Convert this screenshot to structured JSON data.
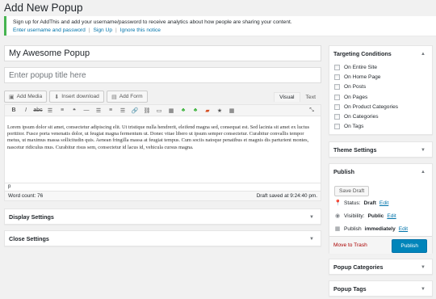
{
  "page": {
    "title": "Add New Popup"
  },
  "notice": {
    "message": "Sign up for AddThis and add your username/password to receive analytics about how people are sharing your content.",
    "links": [
      "Enter username and password",
      "Sign Up",
      "Ignore this notice"
    ],
    "accent_color": "#46b450"
  },
  "editor": {
    "title_value": "My Awesome Popup",
    "subtitle_placeholder": "Enter popup title here",
    "media_buttons": [
      {
        "label": "Add Media",
        "icon": "media-icon"
      },
      {
        "label": "Insert download",
        "icon": "download-icon"
      },
      {
        "label": "Add Form",
        "icon": "form-icon"
      }
    ],
    "tabs": [
      "Visual",
      "Text"
    ],
    "toolbar_icons": [
      "bold-icon",
      "italic-icon",
      "strikethrough-icon",
      "bullet-list-icon",
      "numbered-list-icon",
      "blockquote-icon",
      "horizontal-line-icon",
      "align-left-icon",
      "align-center-icon",
      "align-right-icon",
      "link-icon",
      "unlink-icon",
      "insert-more-icon",
      "toolbar-toggle-icon",
      "shortcode-green-icon",
      "shortcode-green-2-icon",
      "shortcode-red-icon",
      "star-icon",
      "table-icon",
      "fullscreen-icon"
    ],
    "content": "Lorem ipsum dolor sit amet, consectetur adipiscing elit. Ut tristique nulla hendrerit, eleifend magna sed, consequat est. Sed lacinia sit amet ex luctus porttitor. Fusce porta venenatis dolor, ut feugiat magna fermentum ut. Donec vitae libero ut ipsum semper consectetur. Curabitur convallis tempor metus, ut maximus massa sollicitudin quis. Aenean fringilla massa at feugiat tempus. Cum sociis natoque penatibus et magnis dis parturient montes, nascetur ridiculus mus. Curabitur risus sem, consectetur id lacus id, vehicula cursus magna.",
    "path": "p",
    "word_count": "Word count: 76",
    "draft_saved": "Draft saved at 9:24:40 pm."
  },
  "left_panels": [
    {
      "label": "Display Settings"
    },
    {
      "label": "Close Settings"
    }
  ],
  "sidebar": {
    "targeting": {
      "title": "Targeting Conditions",
      "options": [
        "On Entire Site",
        "On Home Page",
        "On Posts",
        "On Pages",
        "On Product Categories",
        "On Categories",
        "On Tags"
      ]
    },
    "theme_settings": {
      "title": "Theme Settings"
    },
    "publish": {
      "title": "Publish",
      "save_draft": "Save Draft",
      "status_label": "Status:",
      "status_value": "Draft",
      "visibility_label": "Visibility:",
      "visibility_value": "Public",
      "publish_label": "Publish",
      "publish_value": "immediately",
      "edit": "Edit",
      "trash": "Move to Trash",
      "publish_button": "Publish",
      "button_color": "#0085ba"
    },
    "popup_categories": {
      "title": "Popup Categories"
    },
    "popup_tags": {
      "title": "Popup Tags"
    }
  }
}
